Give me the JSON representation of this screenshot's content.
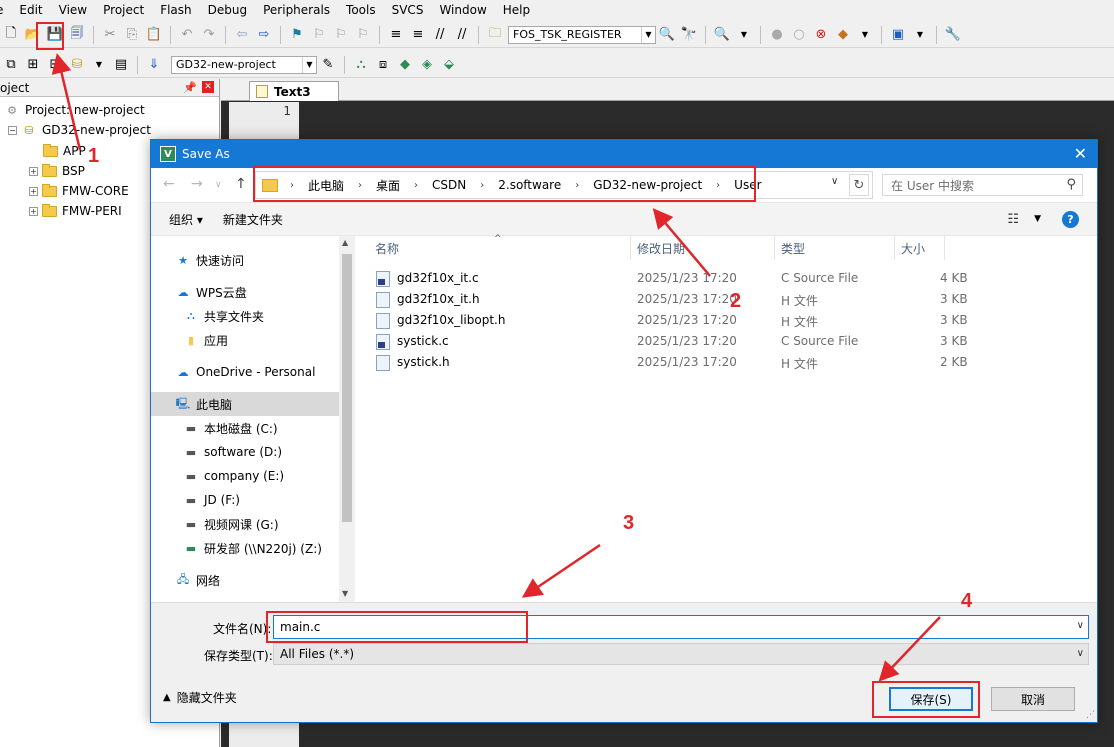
{
  "ide": {
    "menu": [
      "e",
      "Edit",
      "View",
      "Project",
      "Flash",
      "Debug",
      "Peripherals",
      "Tools",
      "SVCS",
      "Window",
      "Help"
    ],
    "toolbar1_combo": "FOS_TSK_REGISTER",
    "toolbar2_combo": "GD32-new-project",
    "project_pane_title": "oject",
    "tree": {
      "root": "Project: new-project",
      "target": "GD32-new-project",
      "folders": [
        "APP",
        "BSP",
        "FMW-CORE",
        "FMW-PERI"
      ]
    },
    "editor_tab": "Text3",
    "line_number": "1"
  },
  "dialog": {
    "title": "Save As",
    "title_icon_letter": "V",
    "breadcrumb": [
      "此电脑",
      "桌面",
      "CSDN",
      "2.software",
      "GD32-new-project",
      "User"
    ],
    "search_placeholder": "在 User 中搜索",
    "organize": "组织 ▾",
    "new_folder": "新建文件夹",
    "nav_items": [
      {
        "label": "快速访问",
        "icon": "star-icon"
      },
      {
        "label": "WPS云盘",
        "icon": "cloud-icon"
      },
      {
        "label": "共享文件夹",
        "icon": "share-icon"
      },
      {
        "label": "应用",
        "icon": "app-icon"
      },
      {
        "label": "OneDrive - Personal",
        "icon": "onedrive-icon"
      },
      {
        "label": "此电脑",
        "icon": "pc-icon"
      },
      {
        "label": "本地磁盘 (C:)",
        "icon": "drive-icon"
      },
      {
        "label": "software (D:)",
        "icon": "drive-icon"
      },
      {
        "label": "company (E:)",
        "icon": "drive-icon"
      },
      {
        "label": "JD (F:)",
        "icon": "drive-icon"
      },
      {
        "label": "视频网课 (G:)",
        "icon": "drive-icon"
      },
      {
        "label": "研发部 (\\\\N220j) (Z:)",
        "icon": "network-drive-icon"
      },
      {
        "label": "网络",
        "icon": "network-icon"
      }
    ],
    "columns": {
      "name": "名称",
      "date": "修改日期",
      "type": "类型",
      "size": "大小"
    },
    "files": [
      {
        "name": "gd32f10x_it.c",
        "date": "2025/1/23 17:20",
        "type": "C Source File",
        "size": "4 KB",
        "kind": "c"
      },
      {
        "name": "gd32f10x_it.h",
        "date": "2025/1/23 17:20",
        "type": "H 文件",
        "size": "3 KB",
        "kind": "h"
      },
      {
        "name": "gd32f10x_libopt.h",
        "date": "2025/1/23 17:20",
        "type": "H 文件",
        "size": "3 KB",
        "kind": "h"
      },
      {
        "name": "systick.c",
        "date": "2025/1/23 17:20",
        "type": "C Source File",
        "size": "3 KB",
        "kind": "c"
      },
      {
        "name": "systick.h",
        "date": "2025/1/23 17:20",
        "type": "H 文件",
        "size": "2 KB",
        "kind": "h"
      }
    ],
    "filename_label": "文件名(N):",
    "filename_value": "main.c",
    "filetype_label": "保存类型(T):",
    "filetype_value": "All Files (*.*)",
    "hide_folders": "隐藏文件夹",
    "save_button": "保存(S)",
    "cancel_button": "取消"
  },
  "annotations": {
    "step1": "1",
    "step2": "2",
    "step3": "3",
    "step4": "4",
    "color": "#e0262a"
  }
}
